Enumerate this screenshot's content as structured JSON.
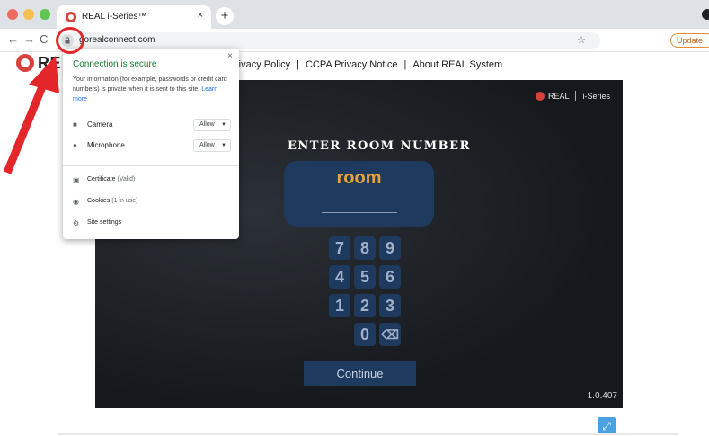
{
  "browser": {
    "tab_title": "REAL i-Series™",
    "tab_close": "×",
    "new_tab": "+",
    "url": "gorealconnect.com",
    "update_label": "Update",
    "nav_back": "←",
    "nav_forward": "→",
    "nav_reload": "C",
    "bookmark_star": "☆"
  },
  "site": {
    "brand": "RE",
    "nav_items": [
      "rivacy Policy",
      "CCPA Privacy Notice",
      "About REAL System"
    ],
    "nav_separator": "|"
  },
  "popup": {
    "close": "×",
    "title": "Connection is secure",
    "description": "Your information (for example, passwords or credit card numbers) is private when it is sent to this site.",
    "learn_more": "Learn more",
    "permissions": [
      {
        "icon": "camera-icon",
        "label": "Camera",
        "value": "Allow"
      },
      {
        "icon": "microphone-icon",
        "label": "Microphone",
        "value": "Allow"
      }
    ],
    "certificate": {
      "label": "Certificate",
      "sub": "(Valid)"
    },
    "cookies": {
      "label": "Cookies",
      "sub": "(1 in use)"
    },
    "site_settings": {
      "label": "Site settings"
    }
  },
  "app": {
    "brand_logo_text": "REAL",
    "brand_series": "i-Series",
    "heading": "ENTER ROOM NUMBER",
    "room_value": "room",
    "keys": {
      "k7": "7",
      "k8": "8",
      "k9": "9",
      "k4": "4",
      "k5": "5",
      "k6": "6",
      "k1": "1",
      "k2": "2",
      "k3": "3",
      "k0": "0",
      "del": "⌫"
    },
    "continue_label": "Continue",
    "version": "1.0.407"
  },
  "fullscreen_icon": "⤢",
  "colors": {
    "accent": "#e3262a",
    "secure_green": "#188038",
    "room_box": "#1f3a5f",
    "room_value": "#e3a23b",
    "fullscreen": "#4aa3e0"
  }
}
